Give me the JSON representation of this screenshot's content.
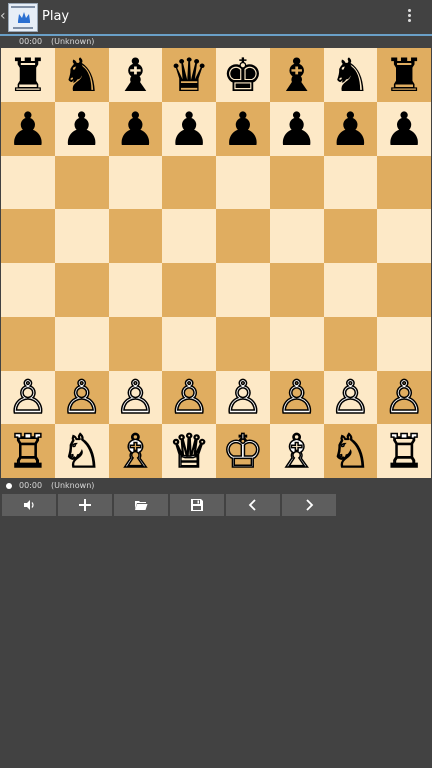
{
  "appbar": {
    "title": "Play",
    "icon": "app-logo-icon",
    "menu_icon": "overflow-menu-icon"
  },
  "status_top": {
    "time": "00:00",
    "player": "(Unknown)"
  },
  "status_bottom": {
    "time": "00:00",
    "player": "(Unknown)"
  },
  "board": {
    "light_color": "#fde9c7",
    "dark_color": "#e0ad60",
    "rows": [
      [
        "♜",
        "♞",
        "♝",
        "♛",
        "♚",
        "♝",
        "♞",
        "♜"
      ],
      [
        "♟",
        "♟",
        "♟",
        "♟",
        "♟",
        "♟",
        "♟",
        "♟"
      ],
      [
        "",
        "",
        "",
        "",
        "",
        "",
        "",
        ""
      ],
      [
        "",
        "",
        "",
        "",
        "",
        "",
        "",
        ""
      ],
      [
        "",
        "",
        "",
        "",
        "",
        "",
        "",
        ""
      ],
      [
        "",
        "",
        "",
        "",
        "",
        "",
        "",
        ""
      ],
      [
        "♙",
        "♙",
        "♙",
        "♙",
        "♙",
        "♙",
        "♙",
        "♙"
      ],
      [
        "♖",
        "♘",
        "♗",
        "♕",
        "♔",
        "♗",
        "♘",
        "♖"
      ]
    ]
  },
  "toolbar": {
    "buttons": [
      {
        "icon": "volume-icon"
      },
      {
        "icon": "plus-icon"
      },
      {
        "icon": "folder-open-icon"
      },
      {
        "icon": "save-icon"
      },
      {
        "icon": "chevron-left-icon"
      },
      {
        "icon": "chevron-right-icon"
      }
    ]
  }
}
